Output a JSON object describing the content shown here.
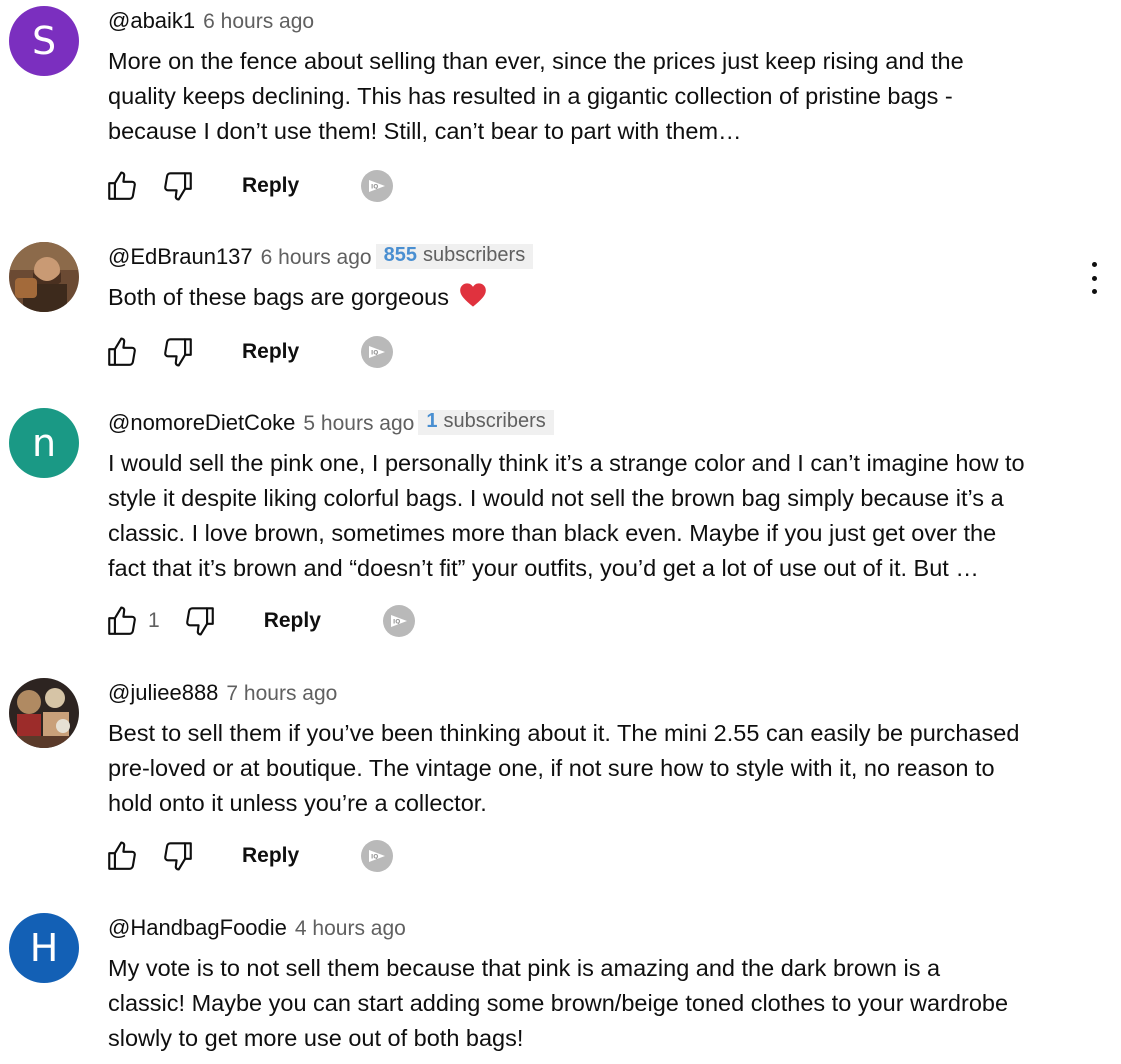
{
  "comments": [
    {
      "handle": "@abaik1",
      "time": "6 hours ago",
      "avatar_letter": "S",
      "avatar_color": "#7b2fbf",
      "text_lines": [
        "More on the fence about selling than ever, since the prices just keep rising and the",
        "quality keeps declining. This has resulted in a gigantic collection of pristine bags -",
        "because I don’t use them! Still, can’t bear to part with them…"
      ],
      "reply_label": "Reply"
    },
    {
      "handle": "@EdBraun137",
      "time": "6 hours ago",
      "subscriber_count": "855",
      "subscriber_label": "subscribers",
      "text": "Both of these bags are gorgeous",
      "emoji": "red-heart",
      "reply_label": "Reply"
    },
    {
      "handle": "@nomoreDietCoke",
      "time": "5 hours ago",
      "subscriber_count": "1",
      "subscriber_label": "subscribers",
      "avatar_letter": "n",
      "avatar_color": "#1a9985",
      "text_lines": [
        "I would sell the pink one, I personally think it’s a strange color and I can’t imagine how to",
        "style it despite liking colorful bags. I would not sell the brown bag simply because it’s a",
        "classic. I love brown, sometimes more than black even. Maybe if you just get over the",
        "fact that it’s brown and “doesn’t fit” your outfits, you’d get a lot of use out of it. But …"
      ],
      "like_count": "1",
      "reply_label": "Reply"
    },
    {
      "handle": "@juliee888",
      "time": "7 hours ago",
      "text_lines": [
        "Best to sell them if you’ve been thinking about it. The mini 2.55 can easily be purchased",
        "pre-loved or at boutique. The vintage one, if not sure how to style with it, no reason to",
        "hold onto it unless you’re a collector."
      ],
      "reply_label": "Reply"
    },
    {
      "handle": "@HandbagFoodie",
      "time": "4 hours ago",
      "avatar_letter": "H",
      "avatar_color": "#1360b5",
      "text_lines": [
        "My vote is to not sell them because that pink is amazing and the dark brown is a",
        "classic! Maybe you can start adding some brown/beige toned clothes to your wardrobe",
        "slowly to get more use out of both bags!"
      ]
    }
  ],
  "colors": {
    "text": "#0f0f0f",
    "secondary_text": "#606060",
    "subscriber_count": "#4a8fd1",
    "subscriber_badge_bg": "#f0f0f0",
    "creator_badge": "#b9b9b9",
    "heart": "#e0323e"
  },
  "icons": [
    "thumbs-up-icon",
    "thumbs-down-icon",
    "creator-heart-badge-icon",
    "more-vert-icon",
    "red-heart-emoji"
  ]
}
